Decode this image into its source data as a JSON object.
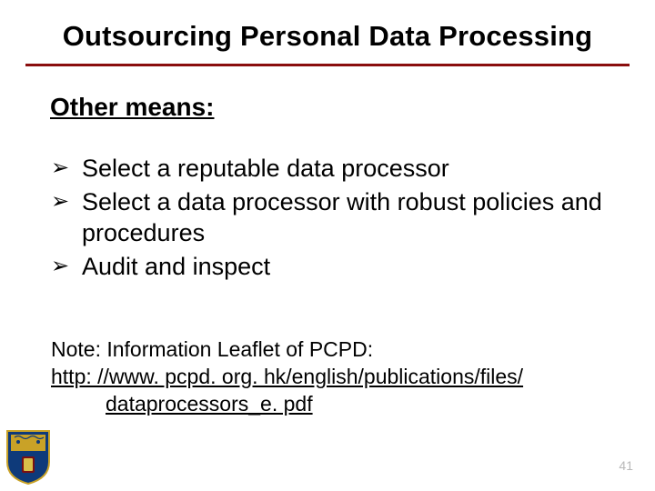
{
  "title": "Outsourcing Personal Data Processing",
  "subheading": "Other means:",
  "bullets": [
    "Select a reputable data processor",
    "Select a data processor with robust policies and procedures",
    "Audit and inspect"
  ],
  "note": {
    "label": "Note: Information Leaflet of PCPD:",
    "url_line1": "http: //www. pcpd. org. hk/english/publications/files/",
    "url_line2": "dataprocessors_e. pdf"
  },
  "page_number": "41",
  "accent_color": "#8a0e0e"
}
